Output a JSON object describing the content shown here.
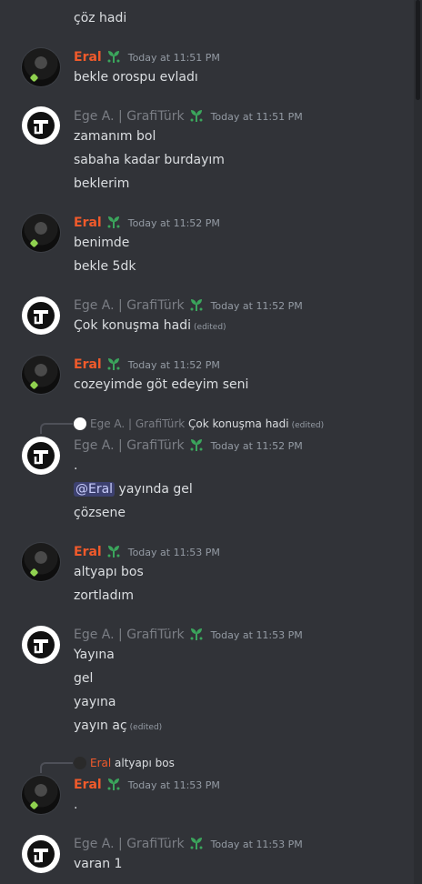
{
  "users": {
    "eral": "Eral",
    "ege": "Ege A. | GrafiTürk"
  },
  "messages": {
    "m0": {
      "text": "çöz hadi"
    },
    "m1": {
      "time": "Today at 11:51 PM",
      "lines": [
        "bekle orospu evladı"
      ]
    },
    "m2": {
      "time": "Today at 11:51 PM",
      "lines": [
        "zamanım bol",
        "sabaha kadar burdayım",
        "beklerim"
      ]
    },
    "m3": {
      "time": "Today at 11:52 PM",
      "lines": [
        "benimde",
        "bekle 5dk"
      ]
    },
    "m4": {
      "time": "Today at 11:52 PM",
      "text": "Çok konuşma hadi",
      "edited": "(edited)"
    },
    "m5": {
      "time": "Today at 11:52 PM",
      "lines": [
        "cozeyimde göt edeyim seni"
      ]
    },
    "m6": {
      "reply_name": "Ege A. | GrafiTürk",
      "reply_text": "Çok konuşma hadi",
      "reply_edited": "(edited)",
      "time": "Today at 11:52 PM",
      "line1": ".",
      "mention": "@Eral",
      "line2_rest": " yayında gel",
      "line3": "çözsene"
    },
    "m7": {
      "time": "Today at 11:53 PM",
      "lines": [
        "altyapı bos",
        "zortladım"
      ]
    },
    "m8": {
      "time": "Today at 11:53 PM",
      "lines": [
        "Yayına",
        "gel",
        "yayına"
      ],
      "last": "yayın aç",
      "edited": "(edited)"
    },
    "m9": {
      "reply_name": "Eral",
      "reply_text": "altyapı bos",
      "time": "Today at 11:53 PM",
      "lines": [
        "."
      ]
    },
    "m10": {
      "time": "Today at 11:53 PM",
      "lines": [
        "varan 1"
      ]
    }
  },
  "colors": {
    "background": "#313338",
    "eral_name": "#f05a2b",
    "ege_name": "#7b7e85",
    "mention_bg": "#3e4270"
  },
  "icons": {
    "leaf_badge": "sprout-badge-icon"
  }
}
